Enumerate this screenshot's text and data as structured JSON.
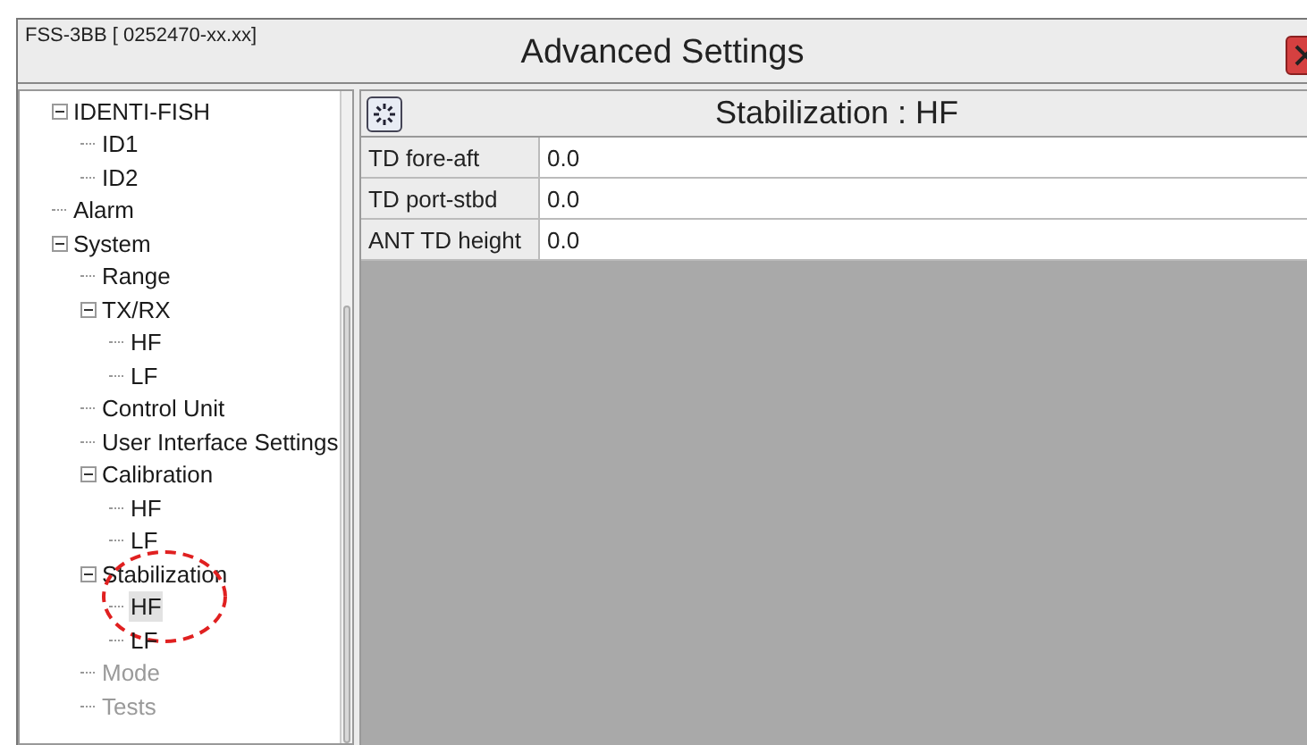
{
  "window": {
    "subtitle": "FSS-3BB [ 0252470-xx.xx]",
    "title": "Advanced Settings"
  },
  "tree": [
    {
      "label": "IDENTI-FISH",
      "expanded": true,
      "selected": false,
      "disabled": false,
      "children": [
        {
          "label": "ID1",
          "selected": false,
          "disabled": false
        },
        {
          "label": "ID2",
          "selected": false,
          "disabled": false
        }
      ]
    },
    {
      "label": "Alarm",
      "selected": false,
      "disabled": false
    },
    {
      "label": "System",
      "expanded": true,
      "selected": false,
      "disabled": false,
      "children": [
        {
          "label": "Range",
          "selected": false,
          "disabled": false
        },
        {
          "label": "TX/RX",
          "expanded": true,
          "selected": false,
          "disabled": false,
          "children": [
            {
              "label": "HF",
              "selected": false,
              "disabled": false
            },
            {
              "label": "LF",
              "selected": false,
              "disabled": false
            }
          ]
        },
        {
          "label": "Control Unit",
          "selected": false,
          "disabled": false
        },
        {
          "label": "User Interface Settings",
          "selected": false,
          "disabled": false
        },
        {
          "label": "Calibration",
          "expanded": true,
          "selected": false,
          "disabled": false,
          "children": [
            {
              "label": "HF",
              "selected": false,
              "disabled": false
            },
            {
              "label": "LF",
              "selected": false,
              "disabled": false
            }
          ]
        },
        {
          "label": "Stabilization",
          "expanded": true,
          "selected": false,
          "disabled": false,
          "annotated": true,
          "children": [
            {
              "label": "HF",
              "selected": true,
              "disabled": false
            },
            {
              "label": "LF",
              "selected": false,
              "disabled": false
            }
          ]
        },
        {
          "label": "Mode",
          "selected": false,
          "disabled": true
        },
        {
          "label": "Tests",
          "selected": false,
          "disabled": true
        }
      ]
    }
  ],
  "panel": {
    "title": "Stabilization : HF",
    "rows": [
      {
        "label": "TD fore-aft",
        "value": "0.0"
      },
      {
        "label": "TD port-stbd",
        "value": "0.0"
      },
      {
        "label": "ANT TD height",
        "value": "0.0"
      }
    ]
  }
}
